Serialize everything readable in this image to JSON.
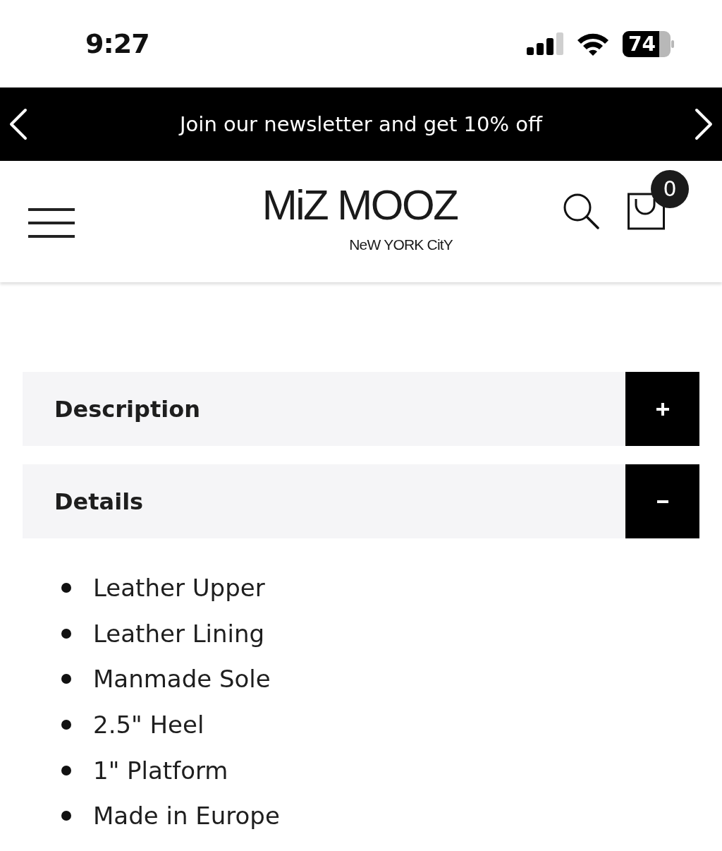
{
  "status_bar": {
    "time": "9:27",
    "battery": "74"
  },
  "promo_banner": {
    "text": "Join our newsletter and get 10% off"
  },
  "header": {
    "logo": {
      "name": "MiZ MOOZ",
      "tagline": "NeW YORK CitY"
    },
    "cart_count": "0"
  },
  "accordion": [
    {
      "title": "Description",
      "expanded": false
    },
    {
      "title": "Details",
      "expanded": true,
      "items": [
        "Leather Upper",
        "Leather Lining",
        "Manmade Sole",
        "2.5\" Heel",
        "1\" Platform",
        "Made in Europe"
      ]
    }
  ]
}
